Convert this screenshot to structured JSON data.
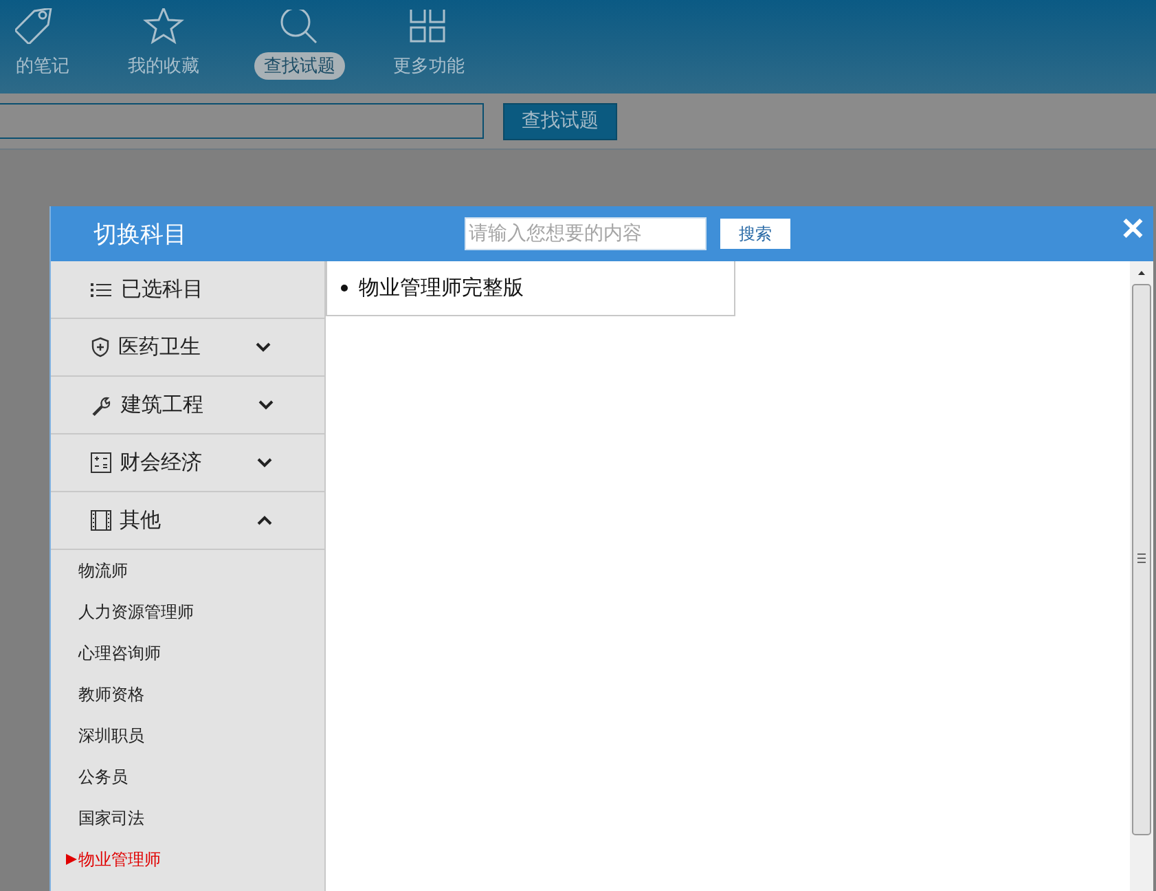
{
  "top_nav": {
    "items": [
      {
        "label": "的笔记",
        "selected": false
      },
      {
        "label": "我的收藏",
        "selected": false
      },
      {
        "label": "查找试题",
        "selected": true
      },
      {
        "label": "更多功能",
        "selected": false
      }
    ]
  },
  "search_row": {
    "button": "查找试题"
  },
  "dialog": {
    "title": "切换科目",
    "search": {
      "placeholder": "请输入您想要的内容",
      "button": "搜索"
    },
    "close": "✕",
    "sidebar": [
      {
        "kind": "chosen",
        "label": "已选科目"
      },
      {
        "kind": "category",
        "label": "医药卫生",
        "expanded": false
      },
      {
        "kind": "category",
        "label": "建筑工程",
        "expanded": false
      },
      {
        "kind": "category",
        "label": "财会经济",
        "expanded": false
      },
      {
        "kind": "category",
        "label": "其他",
        "expanded": true,
        "children": [
          {
            "label": "物流师",
            "selected": false
          },
          {
            "label": "人力资源管理师",
            "selected": false
          },
          {
            "label": "心理咨询师",
            "selected": false
          },
          {
            "label": "教师资格",
            "selected": false
          },
          {
            "label": "深圳职员",
            "selected": false
          },
          {
            "label": "公务员",
            "selected": false
          },
          {
            "label": "国家司法",
            "selected": false
          },
          {
            "label": "物业管理师",
            "selected": true
          }
        ]
      }
    ],
    "chosen_subjects": [
      "物业管理师完整版"
    ]
  }
}
